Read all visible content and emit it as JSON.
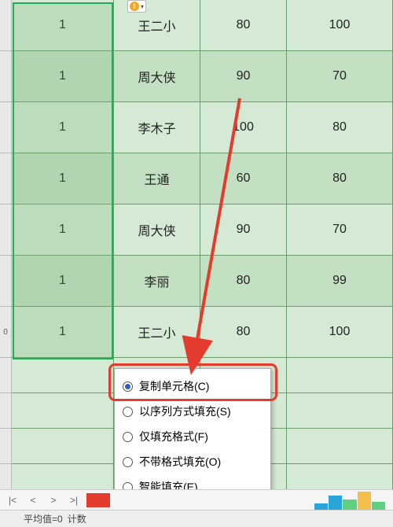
{
  "table": {
    "rows": [
      {
        "c1": "1",
        "c2": "王二小",
        "c3": "80",
        "c4": "100"
      },
      {
        "c1": "1",
        "c2": "周大侠",
        "c3": "90",
        "c4": "70"
      },
      {
        "c1": "1",
        "c2": "李木子",
        "c3": "100",
        "c4": "80"
      },
      {
        "c1": "1",
        "c2": "王通",
        "c3": "60",
        "c4": "80"
      },
      {
        "c1": "1",
        "c2": "周大侠",
        "c3": "90",
        "c4": "70"
      },
      {
        "c1": "1",
        "c2": "李丽",
        "c3": "80",
        "c4": "99"
      },
      {
        "c1": "1",
        "c2": "王二小",
        "c3": "80",
        "c4": "100"
      }
    ],
    "row_header_partial": "0"
  },
  "smart_tag": {
    "glyph": "!"
  },
  "fill_menu": {
    "options": [
      {
        "label": "复制单元格(C)",
        "selected": true
      },
      {
        "label": "以序列方式填充(S)",
        "selected": false
      },
      {
        "label": "仅填充格式(F)",
        "selected": false
      },
      {
        "label": "不带格式填充(O)",
        "selected": false
      },
      {
        "label": "智能填充(E)",
        "selected": false
      }
    ]
  },
  "status": {
    "nav_first": "|<",
    "nav_prev": "<",
    "nav_next": ">",
    "nav_last": ">|",
    "avg_label": "平均值=0",
    "count_label": "计数"
  },
  "colors": {
    "selection_border": "#1fae54",
    "highlight": "#e33b2e",
    "cell_bg": "#d4ead4",
    "cell_bg_alt": "#c3e0c3"
  }
}
